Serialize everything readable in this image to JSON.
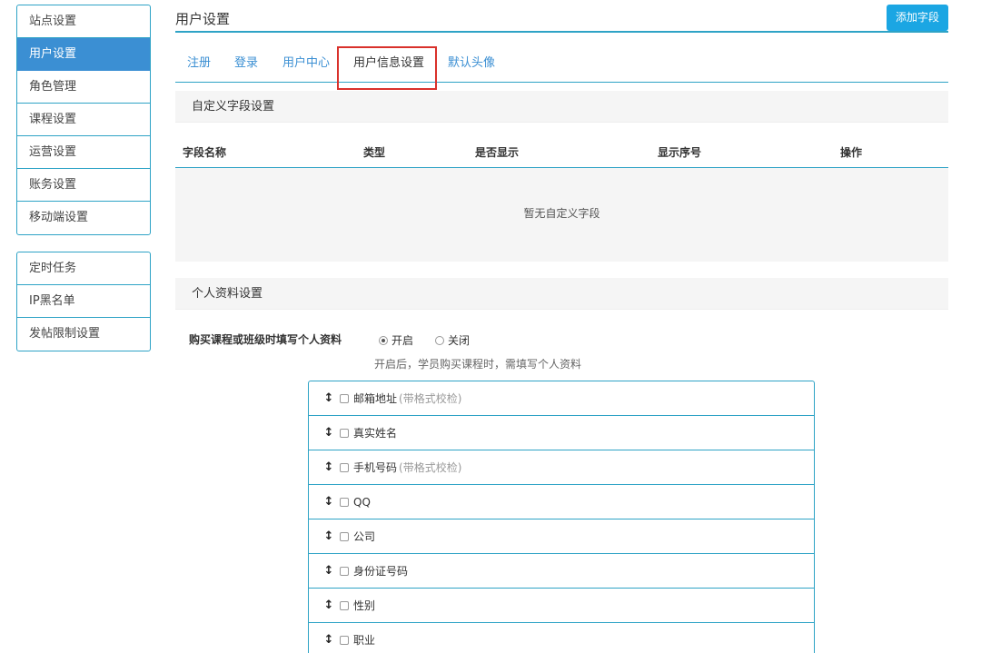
{
  "sidebar": {
    "group1": [
      "站点设置",
      "用户设置",
      "角色管理",
      "课程设置",
      "运营设置",
      "账务设置",
      "移动端设置"
    ],
    "group2": [
      "定时任务",
      "IP黑名单",
      "发帖限制设置"
    ],
    "active": "用户设置"
  },
  "header": {
    "title": "用户设置",
    "add_button": "添加字段"
  },
  "tabs": [
    "注册",
    "登录",
    "用户中心",
    "用户信息设置",
    "默认头像"
  ],
  "custom_fields": {
    "title": "自定义字段设置",
    "columns": [
      "字段名称",
      "类型",
      "是否显示",
      "显示序号",
      "操作"
    ],
    "empty_text": "暂无自定义字段"
  },
  "profile": {
    "title": "个人资料设置",
    "option_label": "购买课程或班级时填写个人资料",
    "on_label": "开启",
    "off_label": "关闭",
    "hint": "开启后，学员购买课程时，需填写个人资料",
    "fields": [
      {
        "label": "邮箱地址",
        "note": "(带格式校检)"
      },
      {
        "label": "真实姓名",
        "note": ""
      },
      {
        "label": "手机号码",
        "note": "(带格式校检)"
      },
      {
        "label": "QQ",
        "note": ""
      },
      {
        "label": "公司",
        "note": ""
      },
      {
        "label": "身份证号码",
        "note": ""
      },
      {
        "label": "性别",
        "note": ""
      },
      {
        "label": "职业",
        "note": ""
      }
    ]
  },
  "icons": {
    "drag": "drag-handle-icon",
    "radio_on": "radio-selected-icon"
  },
  "colors": {
    "accent": "#2ea3c6",
    "active_bg": "#3b8fd3",
    "button": "#1ba6e3",
    "highlight": "#d9312b"
  }
}
